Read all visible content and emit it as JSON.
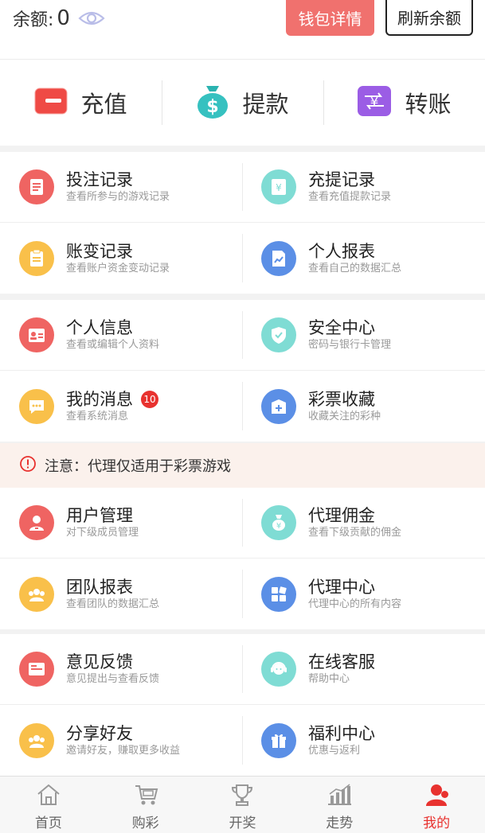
{
  "header": {
    "balance_label": "余额:",
    "balance_value": "0",
    "wallet_button": "钱包详情",
    "refresh_button": "刷新余额"
  },
  "quick_actions": [
    {
      "label": "充值",
      "icon": "card-icon"
    },
    {
      "label": "提款",
      "icon": "money-bag-icon"
    },
    {
      "label": "转账",
      "icon": "transfer-icon"
    }
  ],
  "groups": {
    "records": [
      {
        "title": "投注记录",
        "sub": "查看所参与的游戏记录",
        "icon": "bet-record-icon"
      },
      {
        "title": "充提记录",
        "sub": "查看充值提款记录",
        "icon": "deposit-record-icon"
      },
      {
        "title": "账变记录",
        "sub": "查看账户资金变动记录",
        "icon": "account-change-icon"
      },
      {
        "title": "个人报表",
        "sub": "查看自己的数据汇总",
        "icon": "report-icon"
      }
    ],
    "personal": [
      {
        "title": "个人信息",
        "sub": "查看或编辑个人资料",
        "icon": "profile-card-icon"
      },
      {
        "title": "安全中心",
        "sub": "密码与银行卡管理",
        "icon": "shield-icon"
      },
      {
        "title": "我的消息",
        "sub": "查看系统消息",
        "icon": "message-icon",
        "badge": "10"
      },
      {
        "title": "彩票收藏",
        "sub": "收藏关注的彩种",
        "icon": "favorite-folder-icon"
      }
    ],
    "agent": [
      {
        "title": "用户管理",
        "sub": "对下级成员管理",
        "icon": "user-manage-icon"
      },
      {
        "title": "代理佣金",
        "sub": "查看下级贡献的佣金",
        "icon": "commission-icon"
      },
      {
        "title": "团队报表",
        "sub": "查看团队的数据汇总",
        "icon": "team-icon"
      },
      {
        "title": "代理中心",
        "sub": "代理中心的所有内容",
        "icon": "agent-center-icon"
      }
    ],
    "service": [
      {
        "title": "意见反馈",
        "sub": "意见提出与查看反馈",
        "icon": "feedback-icon"
      },
      {
        "title": "在线客服",
        "sub": "帮助中心",
        "icon": "customer-service-icon"
      },
      {
        "title": "分享好友",
        "sub": "邀请好友，赚取更多收益",
        "icon": "share-icon"
      },
      {
        "title": "福利中心",
        "sub": "优惠与返利",
        "icon": "gift-icon"
      }
    ]
  },
  "notice": "注意：代理仅适用于彩票游戏",
  "tabbar": [
    {
      "label": "首页",
      "icon": "home-icon"
    },
    {
      "label": "购彩",
      "icon": "cart-icon"
    },
    {
      "label": "开奖",
      "icon": "trophy-icon"
    },
    {
      "label": "走势",
      "icon": "chart-icon"
    },
    {
      "label": "我的",
      "icon": "user-icon",
      "active": true
    }
  ],
  "colors": {
    "accent": "#e8322f",
    "wallet_button": "#f0716e",
    "icon_red": "#ef6462",
    "icon_teal": "#7fdcd4",
    "icon_yellow": "#f9c04a",
    "icon_blue": "#5b8fe6",
    "notice_bg": "#fbf1ec"
  }
}
